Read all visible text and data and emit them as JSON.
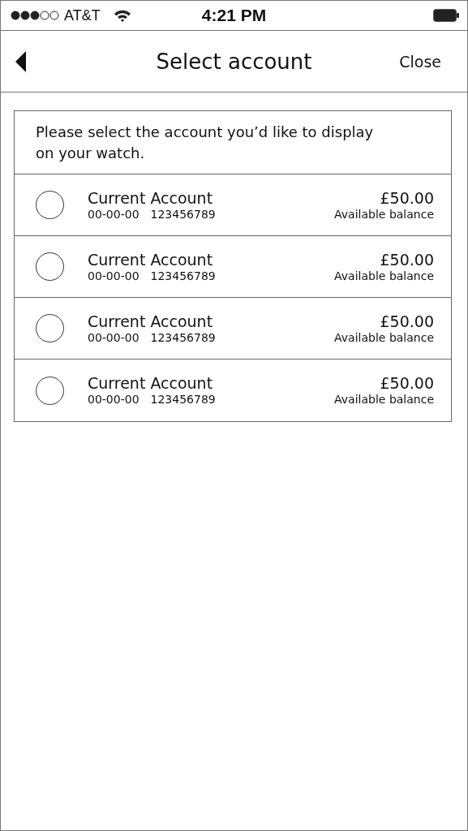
{
  "status_bar": {
    "carrier": "AT&T",
    "time": "4:21 PM"
  },
  "nav": {
    "title": "Select account",
    "close": "Close"
  },
  "intro": "Please select the account you’d like to display on your watch.",
  "accounts": [
    {
      "name": "Current Account",
      "sort_code": "00-00-00",
      "number": "123456789",
      "balance": "£50.00",
      "balance_label": "Available balance",
      "selected": false
    },
    {
      "name": "Current Account",
      "sort_code": "00-00-00",
      "number": "123456789",
      "balance": "£50.00",
      "balance_label": "Available balance",
      "selected": false
    },
    {
      "name": "Current Account",
      "sort_code": "00-00-00",
      "number": "123456789",
      "balance": "£50.00",
      "balance_label": "Available balance",
      "selected": false
    },
    {
      "name": "Current Account",
      "sort_code": "00-00-00",
      "number": "123456789",
      "balance": "£50.00",
      "balance_label": "Available balance",
      "selected": false
    }
  ]
}
